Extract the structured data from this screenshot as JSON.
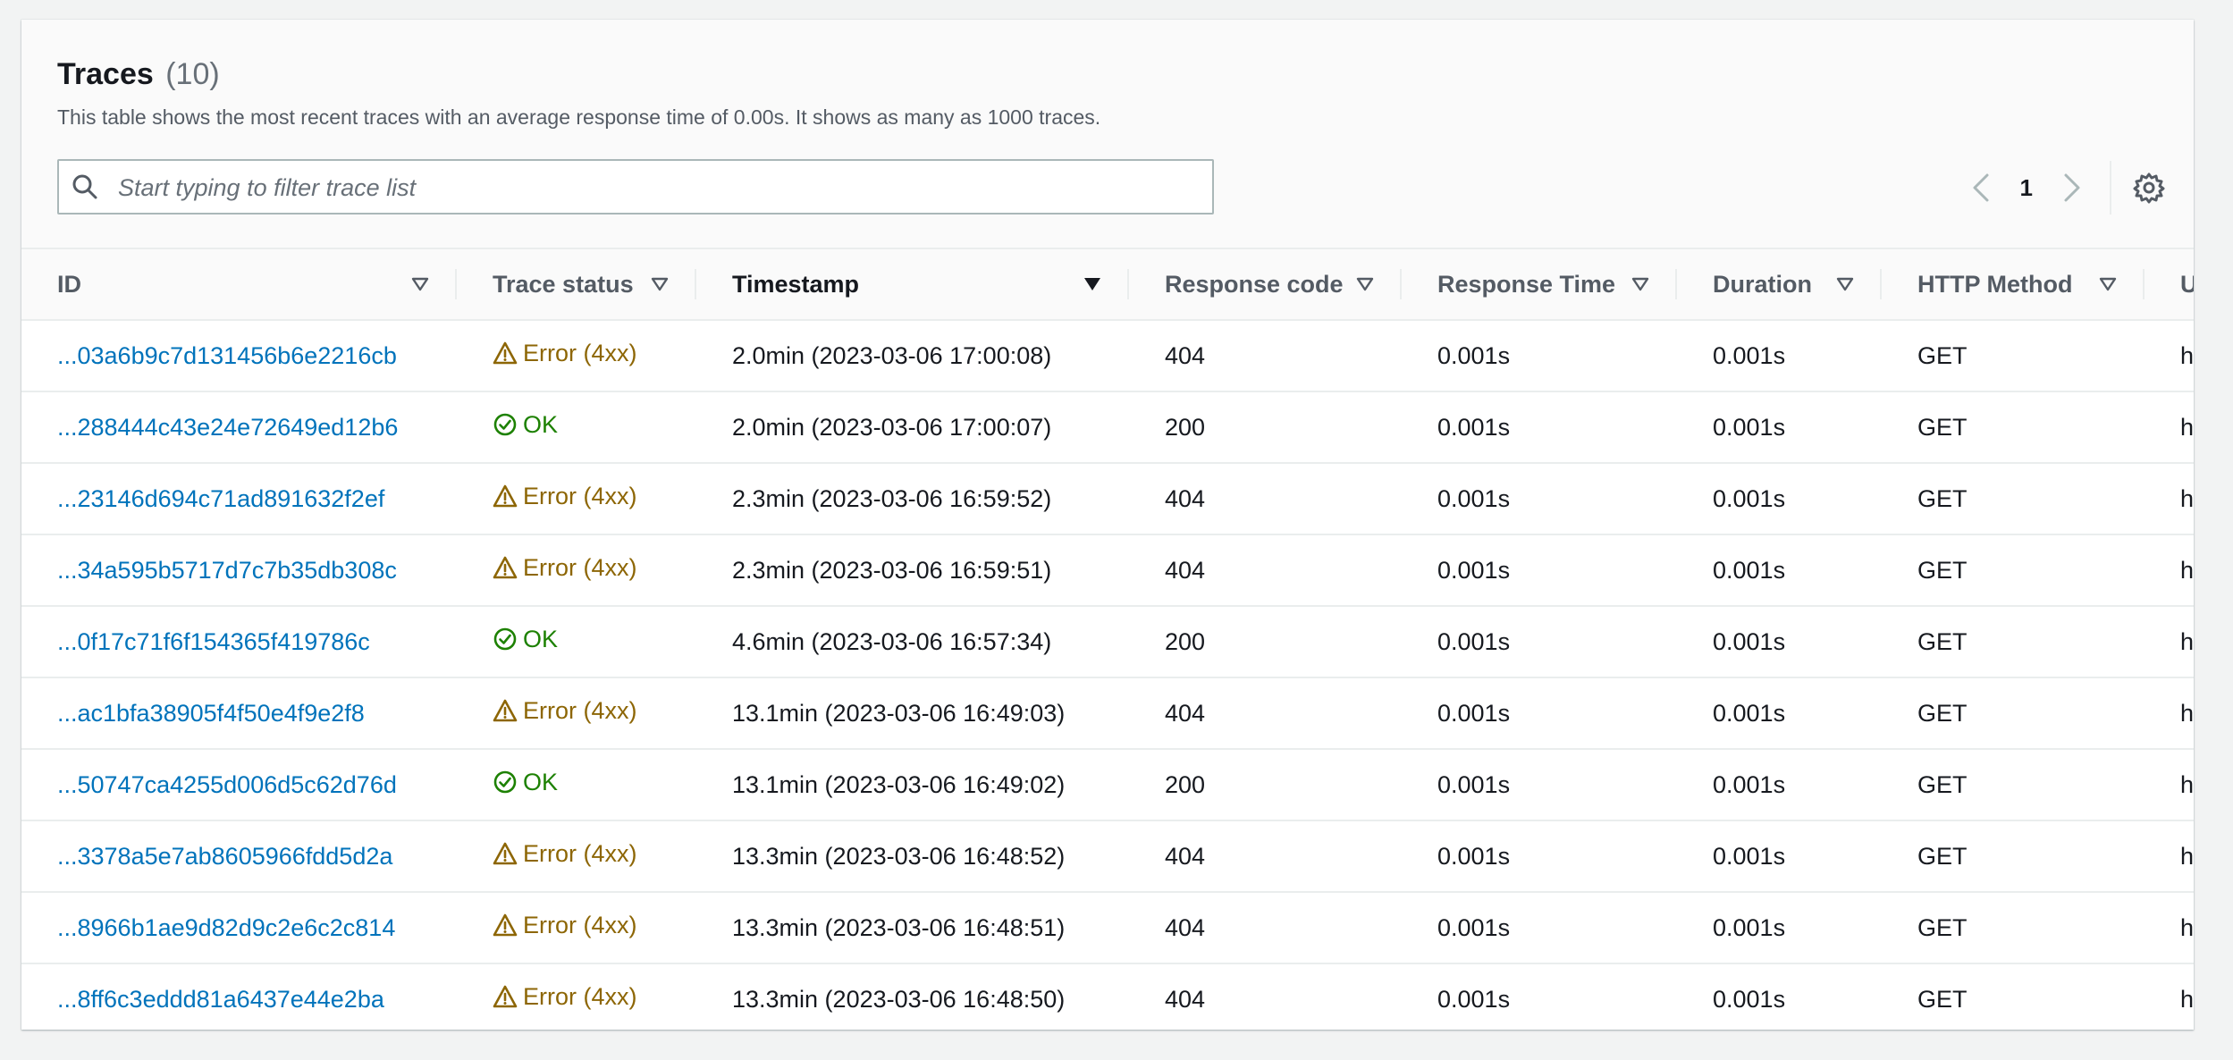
{
  "header": {
    "title": "Traces",
    "count": "(10)",
    "description": "This table shows the most recent traces with an average response time of 0.00s. It shows as many as 1000 traces."
  },
  "search": {
    "placeholder": "Start typing to filter trace list",
    "value": ""
  },
  "pagination": {
    "current_page": "1"
  },
  "colors": {
    "link": "#0073bb",
    "error": "#8d6605",
    "ok": "#1d8102"
  },
  "columns": [
    "ID",
    "Trace status",
    "Timestamp",
    "Response code",
    "Response Time",
    "Duration",
    "HTTP Method",
    "URL"
  ],
  "sorted_column": "Timestamp",
  "rows": [
    {
      "id": "...03a6b9c7d131456b6e2216cb",
      "status": "Error (4xx)",
      "status_type": "error",
      "timestamp": "2.0min (2023-03-06 17:00:08)",
      "code": "404",
      "response_time": "0.001s",
      "duration": "0.001s",
      "method": "GET",
      "url": "h"
    },
    {
      "id": "...288444c43e24e72649ed12b6",
      "status": "OK",
      "status_type": "ok",
      "timestamp": "2.0min (2023-03-06 17:00:07)",
      "code": "200",
      "response_time": "0.001s",
      "duration": "0.001s",
      "method": "GET",
      "url": "h"
    },
    {
      "id": "...23146d694c71ad891632f2ef",
      "status": "Error (4xx)",
      "status_type": "error",
      "timestamp": "2.3min (2023-03-06 16:59:52)",
      "code": "404",
      "response_time": "0.001s",
      "duration": "0.001s",
      "method": "GET",
      "url": "h"
    },
    {
      "id": "...34a595b5717d7c7b35db308c",
      "status": "Error (4xx)",
      "status_type": "error",
      "timestamp": "2.3min (2023-03-06 16:59:51)",
      "code": "404",
      "response_time": "0.001s",
      "duration": "0.001s",
      "method": "GET",
      "url": "h"
    },
    {
      "id": "...0f17c71f6f154365f419786c",
      "status": "OK",
      "status_type": "ok",
      "timestamp": "4.6min (2023-03-06 16:57:34)",
      "code": "200",
      "response_time": "0.001s",
      "duration": "0.001s",
      "method": "GET",
      "url": "h"
    },
    {
      "id": "...ac1bfa38905f4f50e4f9e2f8",
      "status": "Error (4xx)",
      "status_type": "error",
      "timestamp": "13.1min (2023-03-06 16:49:03)",
      "code": "404",
      "response_time": "0.001s",
      "duration": "0.001s",
      "method": "GET",
      "url": "h"
    },
    {
      "id": "...50747ca4255d006d5c62d76d",
      "status": "OK",
      "status_type": "ok",
      "timestamp": "13.1min (2023-03-06 16:49:02)",
      "code": "200",
      "response_time": "0.001s",
      "duration": "0.001s",
      "method": "GET",
      "url": "h"
    },
    {
      "id": "...3378a5e7ab8605966fdd5d2a",
      "status": "Error (4xx)",
      "status_type": "error",
      "timestamp": "13.3min (2023-03-06 16:48:52)",
      "code": "404",
      "response_time": "0.001s",
      "duration": "0.001s",
      "method": "GET",
      "url": "h"
    },
    {
      "id": "...8966b1ae9d82d9c2e6c2c814",
      "status": "Error (4xx)",
      "status_type": "error",
      "timestamp": "13.3min (2023-03-06 16:48:51)",
      "code": "404",
      "response_time": "0.001s",
      "duration": "0.001s",
      "method": "GET",
      "url": "h"
    },
    {
      "id": "...8ff6c3eddd81a6437e44e2ba",
      "status": "Error (4xx)",
      "status_type": "error",
      "timestamp": "13.3min (2023-03-06 16:48:50)",
      "code": "404",
      "response_time": "0.001s",
      "duration": "0.001s",
      "method": "GET",
      "url": "h"
    }
  ]
}
